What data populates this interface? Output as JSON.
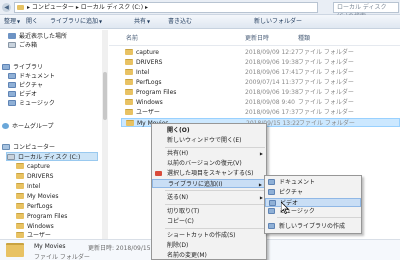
{
  "address": {
    "path": "▸ コンピューター ▸ ローカル ディスク (C:) ▸",
    "search_placeholder": "ローカル ディスク (C:)の検索"
  },
  "toolbar": {
    "organize": "整理",
    "open": "開く",
    "include_library": "ライブラリに追加",
    "share": "共有",
    "burn": "書き込む",
    "new_folder": "新しいフォルダー"
  },
  "nav": {
    "items": [
      {
        "label": "最近表示した場所",
        "icon": "recent-places-icon"
      },
      {
        "label": "ごみ箱",
        "icon": "recycle-bin-icon"
      },
      {
        "label": "ライブラリ",
        "icon": "library-icon"
      },
      {
        "label": "ドキュメント",
        "icon": "documents-library-icon"
      },
      {
        "label": "ピクチャ",
        "icon": "pictures-library-icon"
      },
      {
        "label": "ビデオ",
        "icon": "videos-library-icon"
      },
      {
        "label": "ミュージック",
        "icon": "music-library-icon"
      },
      {
        "label": "ホームグループ",
        "icon": "homegroup-icon"
      },
      {
        "label": "コンピューター",
        "icon": "computer-icon"
      },
      {
        "label": "ローカル ディスク (C:)",
        "icon": "drive-icon"
      },
      {
        "label": "capture",
        "icon": "folder-icon"
      },
      {
        "label": "DRIVERS",
        "icon": "folder-icon"
      },
      {
        "label": "Intel",
        "icon": "folder-icon"
      },
      {
        "label": "My Movies",
        "icon": "folder-icon"
      },
      {
        "label": "PerfLogs",
        "icon": "folder-icon"
      },
      {
        "label": "Program Files",
        "icon": "folder-icon"
      },
      {
        "label": "Windows",
        "icon": "folder-icon"
      },
      {
        "label": "ユーザー",
        "icon": "folder-icon"
      }
    ]
  },
  "content": {
    "headers": {
      "name": "名前",
      "date": "更新日時",
      "type": "種類"
    },
    "rows": [
      {
        "name": "capture",
        "date": "2018/09/09 12:27",
        "type": "ファイル フォルダー"
      },
      {
        "name": "DRIVERS",
        "date": "2018/09/06 19:38",
        "type": "ファイル フォルダー"
      },
      {
        "name": "Intel",
        "date": "2018/09/06 17:41",
        "type": "ファイル フォルダー"
      },
      {
        "name": "PerfLogs",
        "date": "2009/07/14 11:37",
        "type": "ファイル フォルダー"
      },
      {
        "name": "Program Files",
        "date": "2018/09/06 19:38",
        "type": "ファイル フォルダー"
      },
      {
        "name": "Windows",
        "date": "2018/09/08 9:40",
        "type": "ファイル フォルダー"
      },
      {
        "name": "ユーザー",
        "date": "2018/09/06 17:37",
        "type": "ファイル フォルダー"
      },
      {
        "name": "My Movies",
        "date": "2018/09/15 13:22",
        "type": "ファイル フォルダー"
      }
    ]
  },
  "context_menu": {
    "items": [
      {
        "label": "開く(O)"
      },
      {
        "label": "新しいウィンドウで開く(E)"
      },
      {
        "label": "共有(H)"
      },
      {
        "label": "以前のバージョンの復元(V)"
      },
      {
        "label": "選択した項目をスキャンする(S)"
      },
      {
        "label": "ライブラリに追加(I)"
      },
      {
        "label": "送る(N)"
      },
      {
        "label": "切り取り(T)"
      },
      {
        "label": "コピー(C)"
      },
      {
        "label": "ショートカットの作成(S)"
      },
      {
        "label": "削除(D)"
      },
      {
        "label": "名前の変更(M)"
      }
    ]
  },
  "submenu": {
    "items": [
      {
        "label": "ドキュメント"
      },
      {
        "label": "ピクチャ"
      },
      {
        "label": "ビデオ"
      },
      {
        "label": "ミュージック"
      },
      {
        "label": "新しいライブラリの作成"
      }
    ]
  },
  "details": {
    "name": "My Movies",
    "modified": "更新日時: 2018/09/15 13",
    "type": "ファイル フォルダー"
  },
  "colors": {
    "selection": "#cce8ff",
    "menu_highlight": "#c9def5",
    "folder": "#e8c263"
  }
}
